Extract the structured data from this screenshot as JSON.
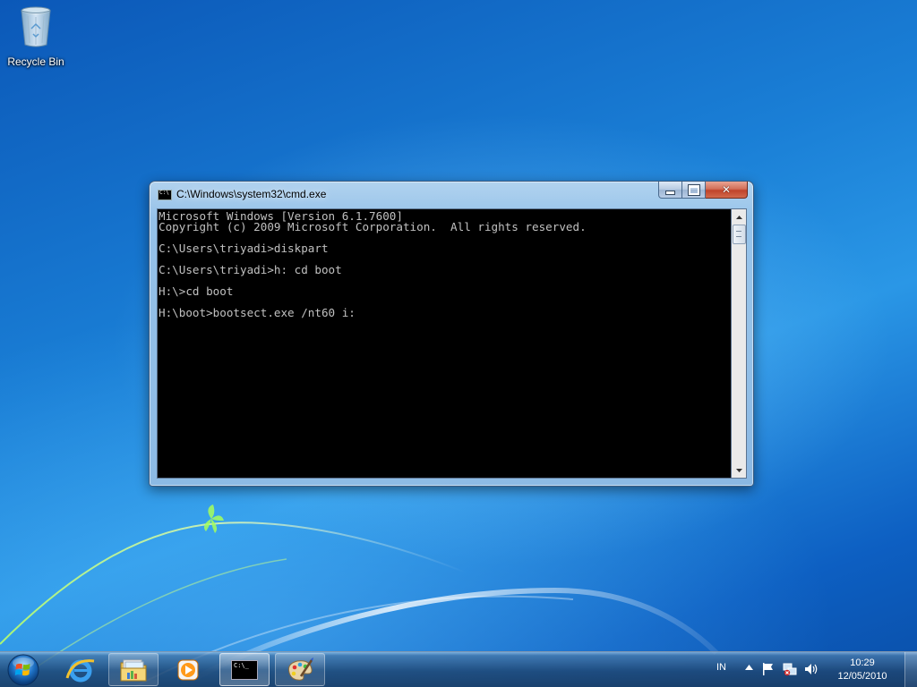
{
  "desktop": {
    "icons": [
      {
        "label": "Recycle Bin",
        "icon": "recycle-bin-icon"
      }
    ]
  },
  "window": {
    "title": "C:\\Windows\\system32\\cmd.exe",
    "icon": "cmd-icon",
    "console_lines": [
      "Microsoft Windows [Version 6.1.7600]",
      "Copyright (c) 2009 Microsoft Corporation.  All rights reserved.",
      "",
      "C:\\Users\\triyadi>diskpart",
      "",
      "C:\\Users\\triyadi>h: cd boot",
      "",
      "H:\\>cd boot",
      "",
      "H:\\boot>bootsect.exe /nt60 i:"
    ],
    "icon_text": "C:\\",
    "buttons": [
      "minimize-icon",
      "maximize-icon",
      "close-icon"
    ],
    "close_glyph": "✕"
  },
  "taskbar": {
    "items": [
      {
        "name": "internet-explorer",
        "icon": "internet-explorer-icon"
      },
      {
        "name": "windows-explorer",
        "icon": "folder-icon"
      },
      {
        "name": "media-player",
        "icon": "media-player-icon"
      },
      {
        "name": "command-prompt",
        "icon": "cmd-icon",
        "active": true,
        "icon_text": "C:\\_"
      },
      {
        "name": "paint",
        "icon": "paint-palette-icon"
      }
    ],
    "tray": {
      "language": "IN",
      "time": "10:29",
      "date": "12/05/2010",
      "icons": [
        "flag-icon",
        "network-icon",
        "volume-icon"
      ]
    }
  },
  "colors": {
    "desktop_blue": "#1a7fd6",
    "console_bg": "#000000",
    "console_text": "#c0c0c0",
    "close_red": "#c0432a"
  }
}
